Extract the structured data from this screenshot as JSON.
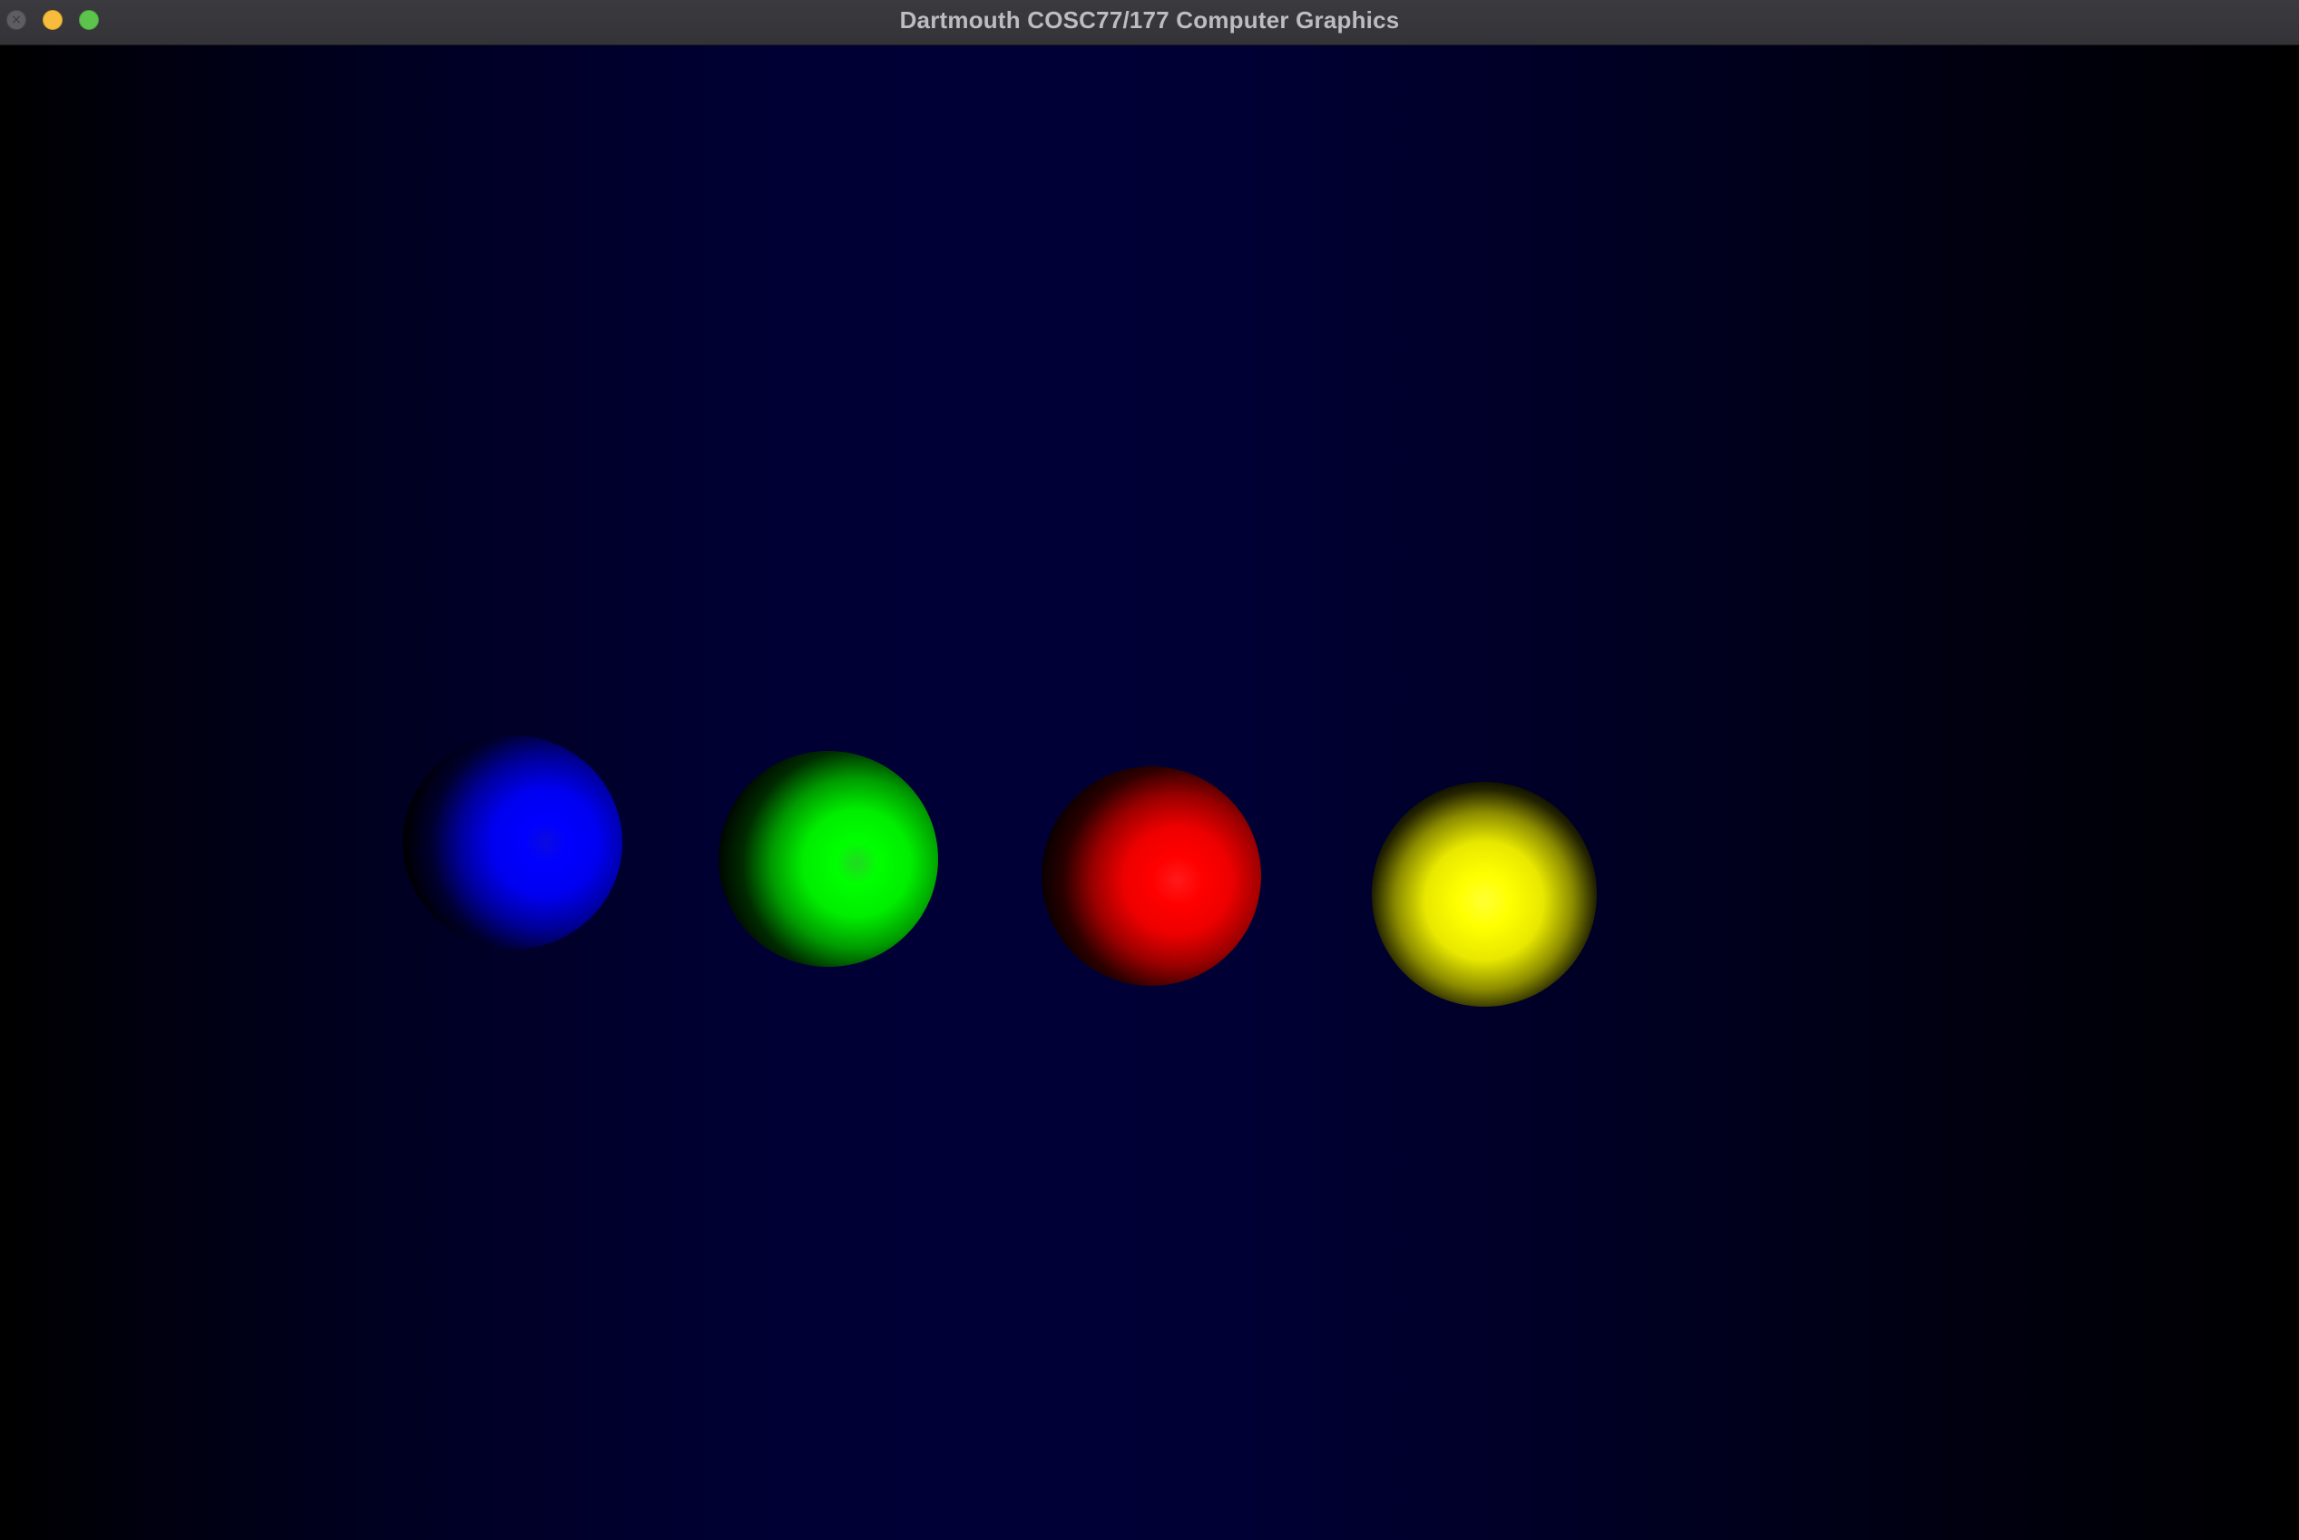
{
  "window": {
    "title": "Dartmouth COSC77/177 Computer Graphics"
  },
  "titlebar_buttons": [
    {
      "name": "close",
      "icon": "close-x-icon",
      "glyph": "×",
      "color": "#5e5d62"
    },
    {
      "name": "minimize",
      "icon": "minimize-icon",
      "color": "#f7bc3b"
    },
    {
      "name": "zoom",
      "icon": "zoom-icon",
      "color": "#5ec34d"
    }
  ],
  "scene": {
    "background_colors": [
      "#000000",
      "#000037"
    ],
    "spheres": [
      {
        "name": "blue",
        "color": "#0000ff"
      },
      {
        "name": "green",
        "color": "#00ff00"
      },
      {
        "name": "red",
        "color": "#ff0000"
      },
      {
        "name": "yellow",
        "color": "#ffff00"
      }
    ]
  }
}
